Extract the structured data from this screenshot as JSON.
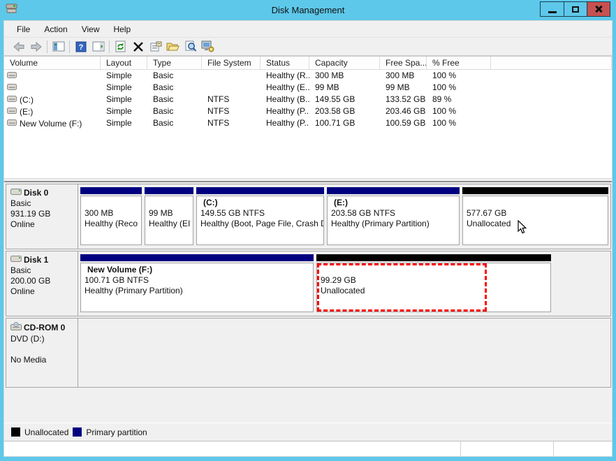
{
  "colors": {
    "titlebar": "#5EC8EA",
    "close_button": "#C75050",
    "primary_partition": "#000080",
    "unallocated": "#000000",
    "selection": "#FF0000"
  },
  "window": {
    "title": "Disk Management",
    "control_icons": [
      "minimize-icon",
      "maximize-icon",
      "close-icon"
    ],
    "app_icon": "disk-drive-icon"
  },
  "menu": {
    "items": [
      "File",
      "Action",
      "View",
      "Help"
    ]
  },
  "toolbar": {
    "icons": [
      "back-icon",
      "forward-icon",
      "console-tree-icon",
      "help-icon",
      "action-pane-icon",
      "refresh-icon",
      "delete-icon",
      "properties-icon",
      "open-icon",
      "find-icon",
      "computer-settings-icon"
    ]
  },
  "volume_list": {
    "columns": [
      "Volume",
      "Layout",
      "Type",
      "File System",
      "Status",
      "Capacity",
      "Free Spa...",
      "% Free"
    ],
    "rows": [
      {
        "volume": "",
        "layout": "Simple",
        "type": "Basic",
        "fs": "",
        "status": "Healthy (R...",
        "capacity": "300 MB",
        "free": "300 MB",
        "pct": "100 %"
      },
      {
        "volume": "",
        "layout": "Simple",
        "type": "Basic",
        "fs": "",
        "status": "Healthy (E...",
        "capacity": "99 MB",
        "free": "99 MB",
        "pct": "100 %"
      },
      {
        "volume": "(C:)",
        "layout": "Simple",
        "type": "Basic",
        "fs": "NTFS",
        "status": "Healthy (B...",
        "capacity": "149.55 GB",
        "free": "133.52 GB",
        "pct": "89 %"
      },
      {
        "volume": "(E:)",
        "layout": "Simple",
        "type": "Basic",
        "fs": "NTFS",
        "status": "Healthy (P...",
        "capacity": "203.58 GB",
        "free": "203.46 GB",
        "pct": "100 %"
      },
      {
        "volume": "New Volume (F:)",
        "layout": "Simple",
        "type": "Basic",
        "fs": "NTFS",
        "status": "Healthy (P...",
        "capacity": "100.71 GB",
        "free": "100.59 GB",
        "pct": "100 %"
      }
    ]
  },
  "disks": [
    {
      "name": "Disk 0",
      "kind": "Basic",
      "size": "931.19 GB",
      "status": "Online",
      "partitions": [
        {
          "title": "",
          "line1": "300 MB",
          "line2": "Healthy (Reco"
        },
        {
          "title": "",
          "line1": "99 MB",
          "line2": "Healthy (EI"
        },
        {
          "title": "(C:)",
          "line1": "149.55 GB NTFS",
          "line2": "Healthy (Boot, Page File, Crash D"
        },
        {
          "title": "(E:)",
          "line1": "203.58 GB NTFS",
          "line2": "Healthy (Primary Partition)"
        },
        {
          "title": "",
          "line1": "577.67 GB",
          "line2": "Unallocated"
        }
      ]
    },
    {
      "name": "Disk 1",
      "kind": "Basic",
      "size": "200.00 GB",
      "status": "Online",
      "partitions": [
        {
          "title": "New Volume  (F:)",
          "line1": "100.71 GB NTFS",
          "line2": "Healthy (Primary Partition)"
        },
        {
          "title": "",
          "line1": "99.29 GB",
          "line2": "Unallocated"
        }
      ]
    },
    {
      "name": "CD-ROM 0",
      "kind": "DVD (D:)",
      "size": "",
      "status": "No Media"
    }
  ],
  "legend": [
    {
      "label": "Unallocated",
      "color": "#000000"
    },
    {
      "label": "Primary partition",
      "color": "#000080"
    }
  ]
}
